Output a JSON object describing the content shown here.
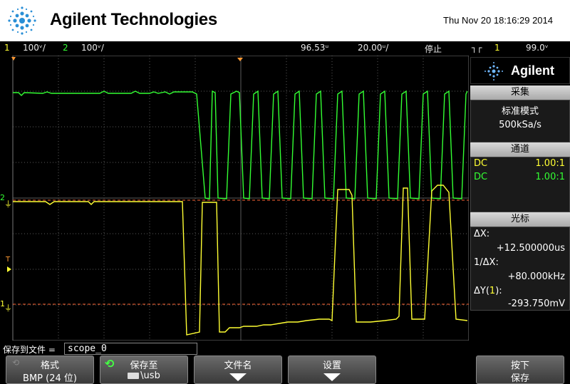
{
  "header": {
    "brand": "Agilent Technologies",
    "datetime": "Thu Nov 20 18:16:29 2014"
  },
  "status": {
    "ch1_num": "1",
    "ch1_scale": "100ᵛ/",
    "ch2_num": "2",
    "ch2_scale": "100ᵛ/",
    "delay": "96.53ᵘ",
    "timebase": "20.00ᵘ/",
    "run_state": "停止",
    "trig_icon": "┐┌",
    "trig_src": "1",
    "trig_level": "99.0ᵛ"
  },
  "side": {
    "logo": "Agilent",
    "acq_title": "采集",
    "acq_mode": "标准模式",
    "acq_rate": "500kSa/s",
    "chan_title": "通道",
    "ch1_coupling": "DC",
    "ch1_probe": "1.00:1",
    "ch2_coupling": "DC",
    "ch2_probe": "1.00:1",
    "cursor_title": "光标",
    "dx_label": "ΔX:",
    "dx_value": "+12.500000us",
    "inv_dx_label": "1/ΔX:",
    "inv_dx_value": "+80.000kHz",
    "dy_label": "ΔY(",
    "dy_ch": "1",
    "dy_label_end": "):",
    "dy_value": "-293.750mV"
  },
  "markers": {
    "ch2_ground": "2",
    "trigger_T": "T",
    "ch1_ground": "1"
  },
  "savebar": {
    "label": "保存到文件 =",
    "filename": "scope_0"
  },
  "softkeys": [
    {
      "top": "格式",
      "bottom": "BMP (24 位)"
    },
    {
      "top": "保存至",
      "bottom": "\\usb"
    },
    {
      "top": "文件名",
      "bottom": ""
    },
    {
      "top": "设置",
      "bottom": ""
    },
    {
      "top": "按下",
      "bottom": "保存"
    }
  ],
  "colors": {
    "ch1": "#ffff33",
    "ch2": "#33ff33",
    "cursor": "#ff6633",
    "grid": "#5a5a5a"
  }
}
